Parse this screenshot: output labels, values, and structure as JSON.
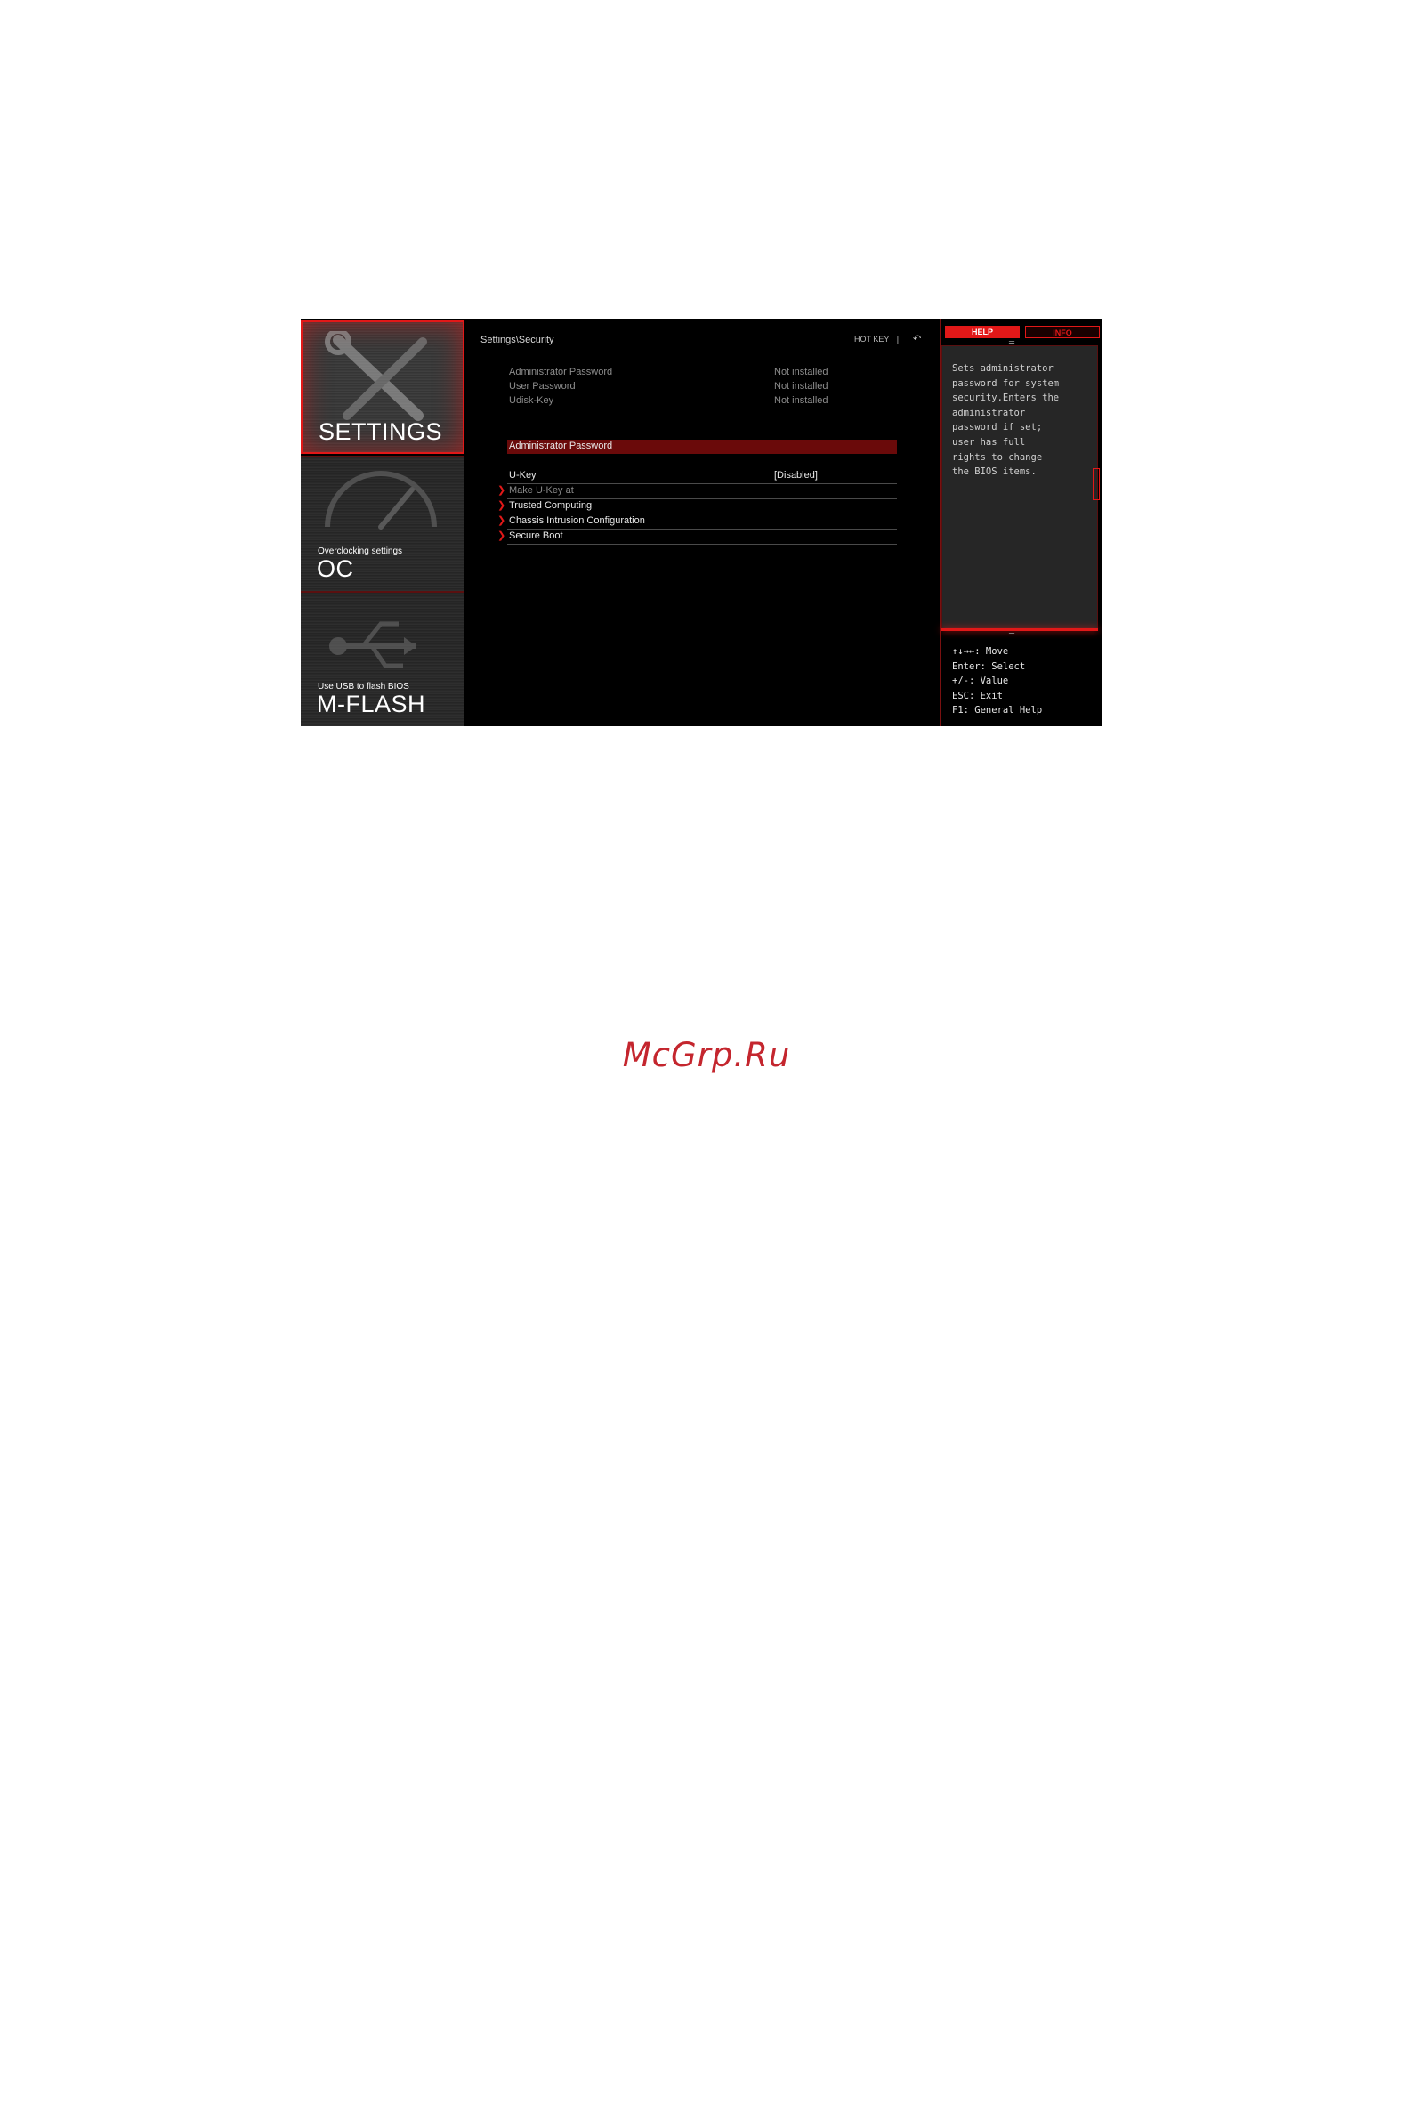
{
  "nav": {
    "settings": {
      "title": "SETTINGS"
    },
    "oc": {
      "subtitle": "Overclocking settings",
      "title": "OC"
    },
    "mflash": {
      "subtitle": "Use USB to flash BIOS",
      "title": "M-FLASH"
    }
  },
  "header": {
    "breadcrumb": "Settings\\Security",
    "hotkey": "HOT KEY",
    "separator": "|",
    "back_glyph": "↶"
  },
  "status_rows": [
    {
      "label": "Administrator Password",
      "value": "Not installed"
    },
    {
      "label": "User Password",
      "value": "Not installed"
    },
    {
      "label": "Udisk-Key",
      "value": "Not installed"
    }
  ],
  "menu": {
    "admin_password": "Administrator Password",
    "ukey": {
      "label": "U-Key",
      "value": "[Disabled]"
    },
    "make_ukey": "Make U-Key at",
    "trusted": "Trusted Computing",
    "chassis": "Chassis Intrusion Configuration",
    "secure_boot": "Secure Boot"
  },
  "right_panel": {
    "tab_help": "HELP",
    "tab_info": "INFO",
    "help_text": "Sets administrator\npassword for system\nsecurity.Enters the\nadministrator\npassword if set;\nuser has full\nrights to change\nthe BIOS items.",
    "keys": [
      "↑↓→←: Move",
      "Enter: Select",
      "+/-: Value",
      "ESC: Exit",
      "F1: General Help"
    ]
  },
  "colors": {
    "accent": "#e21818",
    "selected_row": "#6a0a0a",
    "watermark": "#c4262e"
  },
  "watermark": "McGrp.Ru"
}
